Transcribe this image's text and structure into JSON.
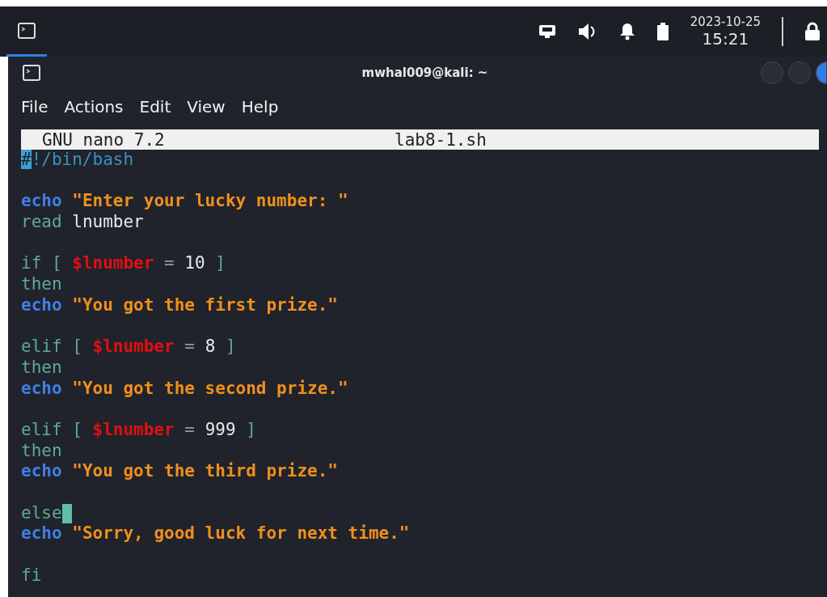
{
  "panel": {
    "taskbar_item": {
      "active": true
    },
    "date": "2023-10-25",
    "time": "15:21"
  },
  "window": {
    "title": "mwhal009@kali: ~"
  },
  "menu": [
    "File",
    "Actions",
    "Edit",
    "View",
    "Help"
  ],
  "nano": {
    "version": "GNU nano 7.2",
    "filename": "lab8-1.sh"
  },
  "lines": [
    {
      "kind": "code",
      "tokens": [
        {
          "kind": "cursor",
          "text": "#"
        },
        {
          "kind": "comment",
          "text": "!/bin/bash"
        }
      ]
    },
    {
      "kind": "blank"
    },
    {
      "kind": "code",
      "tokens": [
        {
          "kind": "builtin",
          "text": "echo"
        },
        {
          "kind": "string",
          "text": "\"Enter your lucky number: \""
        }
      ]
    },
    {
      "kind": "code",
      "tokens": [
        {
          "kind": "keyword",
          "text": "read"
        },
        {
          "kind": "plain",
          "text": "lnumber"
        }
      ]
    },
    {
      "kind": "blank"
    },
    {
      "kind": "code",
      "tokens": [
        {
          "kind": "keyword",
          "text": "if ["
        },
        {
          "kind": "variable",
          "text": "$lnumber"
        },
        {
          "kind": "operator",
          "text": "="
        },
        {
          "kind": "plain",
          "text": "10"
        },
        {
          "kind": "keyword",
          "text": "]"
        }
      ]
    },
    {
      "kind": "code",
      "tokens": [
        {
          "kind": "keyword",
          "text": "then"
        }
      ]
    },
    {
      "kind": "code",
      "tokens": [
        {
          "kind": "builtin",
          "text": "echo"
        },
        {
          "kind": "string",
          "text": "\"You got the first prize.\""
        }
      ]
    },
    {
      "kind": "blank"
    },
    {
      "kind": "code",
      "tokens": [
        {
          "kind": "keyword",
          "text": "elif ["
        },
        {
          "kind": "variable",
          "text": "$lnumber"
        },
        {
          "kind": "operator",
          "text": "="
        },
        {
          "kind": "plain",
          "text": "8"
        },
        {
          "kind": "keyword",
          "text": "]"
        }
      ]
    },
    {
      "kind": "code",
      "tokens": [
        {
          "kind": "keyword",
          "text": "then"
        }
      ]
    },
    {
      "kind": "code",
      "tokens": [
        {
          "kind": "builtin",
          "text": "echo"
        },
        {
          "kind": "string",
          "text": "\"You got the second prize.\""
        }
      ]
    },
    {
      "kind": "blank"
    },
    {
      "kind": "code",
      "tokens": [
        {
          "kind": "keyword",
          "text": "elif ["
        },
        {
          "kind": "variable",
          "text": "$lnumber"
        },
        {
          "kind": "operator",
          "text": "="
        },
        {
          "kind": "plain",
          "text": "999"
        },
        {
          "kind": "keyword",
          "text": "]"
        }
      ]
    },
    {
      "kind": "code",
      "tokens": [
        {
          "kind": "keyword",
          "text": "then"
        }
      ]
    },
    {
      "kind": "code",
      "tokens": [
        {
          "kind": "builtin",
          "text": "echo"
        },
        {
          "kind": "string",
          "text": "\"You got the third prize.\""
        }
      ]
    },
    {
      "kind": "blank"
    },
    {
      "kind": "code",
      "cursor_after": true,
      "tokens": [
        {
          "kind": "keyword",
          "text": "else"
        }
      ]
    },
    {
      "kind": "code",
      "tokens": [
        {
          "kind": "builtin",
          "text": "echo"
        },
        {
          "kind": "string",
          "text": "\"Sorry, good luck for next time.\""
        }
      ]
    },
    {
      "kind": "blank"
    },
    {
      "kind": "code",
      "tokens": [
        {
          "kind": "keyword",
          "text": "fi"
        }
      ]
    }
  ]
}
